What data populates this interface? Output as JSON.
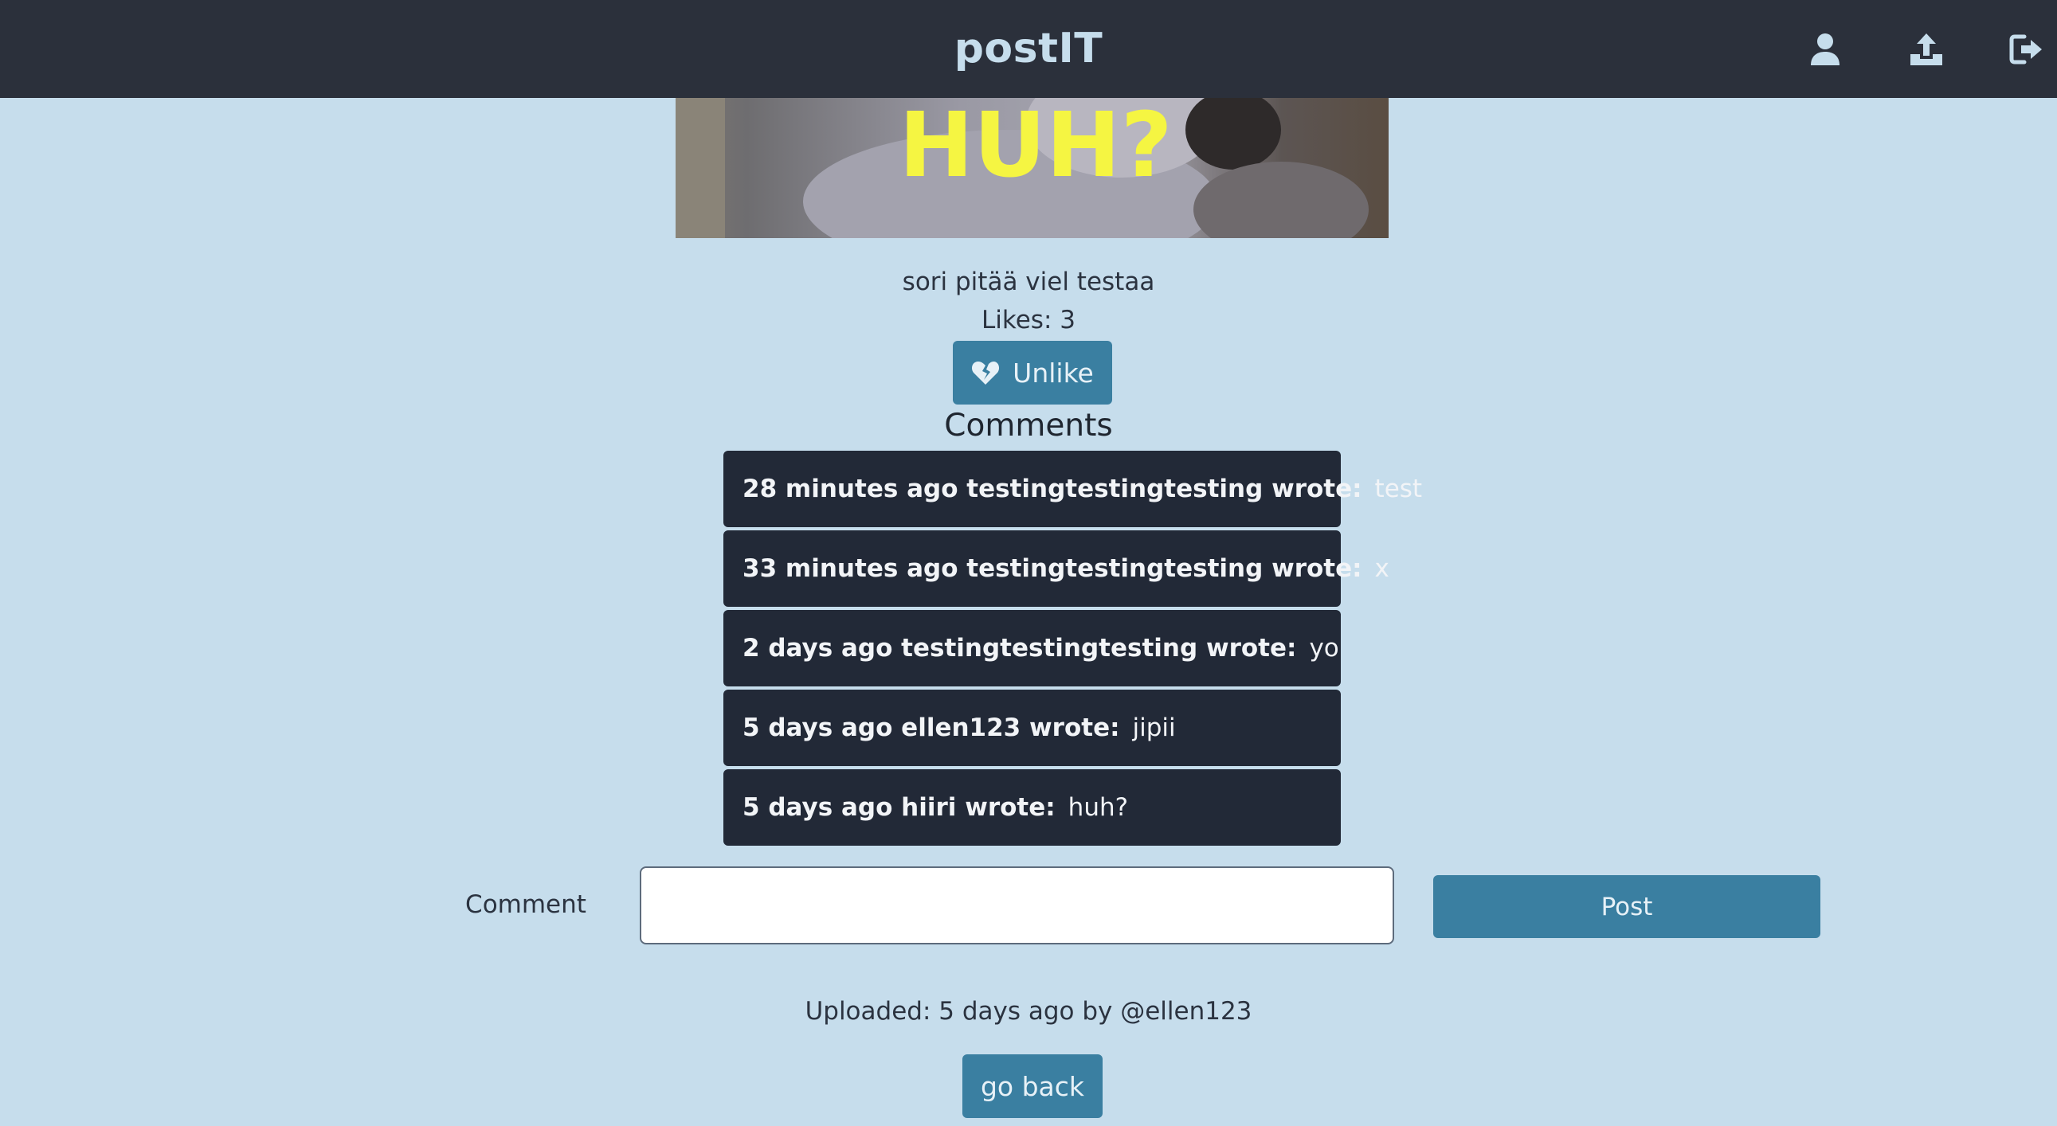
{
  "header": {
    "title": "postIT",
    "icons": [
      "user-icon",
      "upload-icon",
      "logout-icon"
    ]
  },
  "post": {
    "image_text": "HUH?",
    "caption": "sori pitää viel testaa",
    "likes_label": "Likes: 3",
    "unlike_label": "Unlike"
  },
  "comments": {
    "title": "Comments",
    "items": [
      {
        "meta": "28 minutes ago testingtestingtesting wrote:",
        "text": "test"
      },
      {
        "meta": "33 minutes ago testingtestingtesting wrote:",
        "text": "x"
      },
      {
        "meta": "2 days ago testingtestingtesting wrote:",
        "text": "yo"
      },
      {
        "meta": "5 days ago ellen123 wrote:",
        "text": "jipii"
      },
      {
        "meta": "5 days ago hiiri wrote:",
        "text": "huh?"
      }
    ]
  },
  "form": {
    "comment_label": "Comment",
    "comment_value": "",
    "post_label": "Post"
  },
  "footer": {
    "uploaded": "Uploaded: 5 days ago by @ellen123",
    "back_label": "go back"
  },
  "colors": {
    "header_bg": "#2b303b",
    "page_bg": "#c6ddec",
    "button": "#3a7fa1",
    "comment_bg": "#222937",
    "image_text": "#f5f542"
  }
}
